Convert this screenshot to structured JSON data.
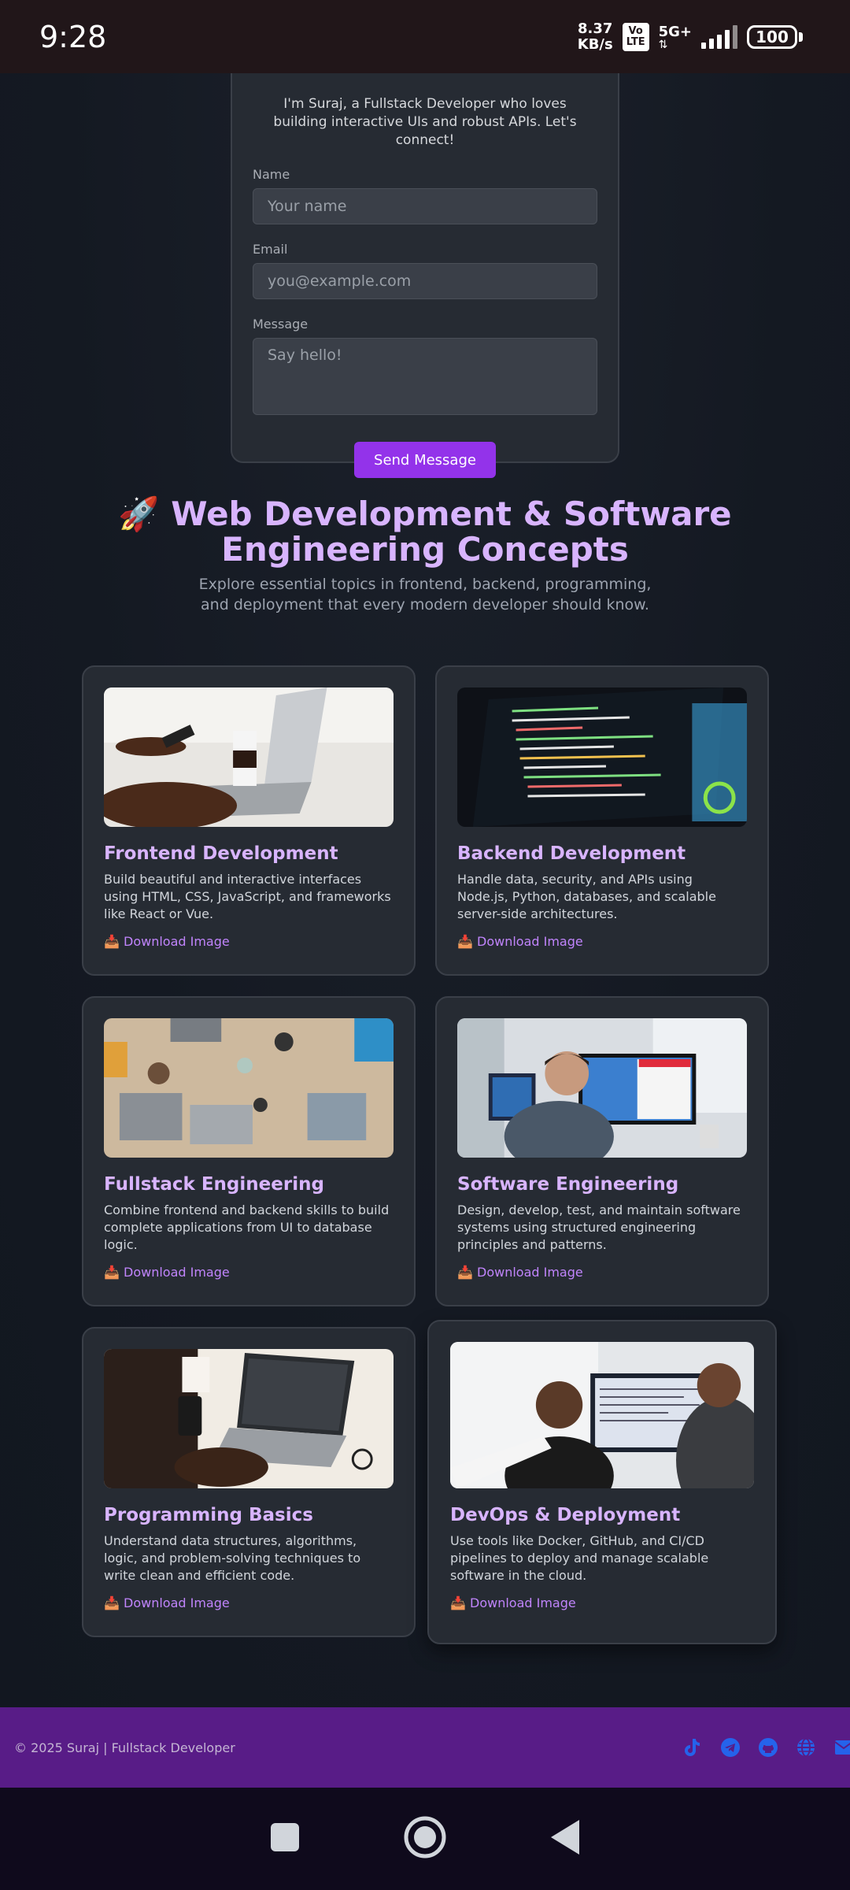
{
  "status_bar": {
    "time": "9:28",
    "net_speed_value": "8.37",
    "net_speed_unit": "KB/s",
    "volte_top": "Vo",
    "volte_bottom": "LTE",
    "network_type": "5G+",
    "battery": "100"
  },
  "contact": {
    "intro": "I'm Suraj, a Fullstack Developer who loves building interactive UIs and robust APIs. Let's connect!",
    "name_label": "Name",
    "name_placeholder": "Your name",
    "email_label": "Email",
    "email_placeholder": "you@example.com",
    "message_label": "Message",
    "message_placeholder": "Say hello!",
    "send_label": "Send Message"
  },
  "section": {
    "title": "🚀 Web Development & Software Engineering Concepts",
    "subtitle": "Explore essential topics in frontend, backend, programming, and deployment that every modern developer should know."
  },
  "cards": [
    {
      "title": "Frontend Development",
      "description": "Build beautiful and interactive interfaces using HTML, CSS, JavaScript, and frameworks like React or Vue.",
      "link": "📥 Download Image"
    },
    {
      "title": "Backend Development",
      "description": "Handle data, security, and APIs using Node.js, Python, databases, and scalable server-side architectures.",
      "link": "📥 Download Image"
    },
    {
      "title": "Fullstack Engineering",
      "description": "Combine frontend and backend skills to build complete applications from UI to database logic.",
      "link": "📥 Download Image"
    },
    {
      "title": "Software Engineering",
      "description": "Design, develop, test, and maintain software systems using structured engineering principles and patterns.",
      "link": "📥 Download Image"
    },
    {
      "title": "Programming Basics",
      "description": "Understand data structures, algorithms, logic, and problem-solving techniques to write clean and efficient code.",
      "link": "📥 Download Image"
    },
    {
      "title": "DevOps & Deployment",
      "description": "Use tools like Docker, GitHub, and CI/CD pipelines to deploy and manage scalable software in the cloud.",
      "link": "📥 Download Image"
    }
  ],
  "footer": {
    "text": "© 2025 Suraj | Fullstack Developer",
    "icons": [
      "tiktok-icon",
      "telegram-icon",
      "github-icon",
      "globe-icon",
      "mail-icon"
    ]
  },
  "colors": {
    "accent": "#9333ea",
    "title": "#d8b4fe",
    "link": "#c084fc",
    "footer_bg": "#581c87",
    "footer_icons": "#2563eb"
  }
}
